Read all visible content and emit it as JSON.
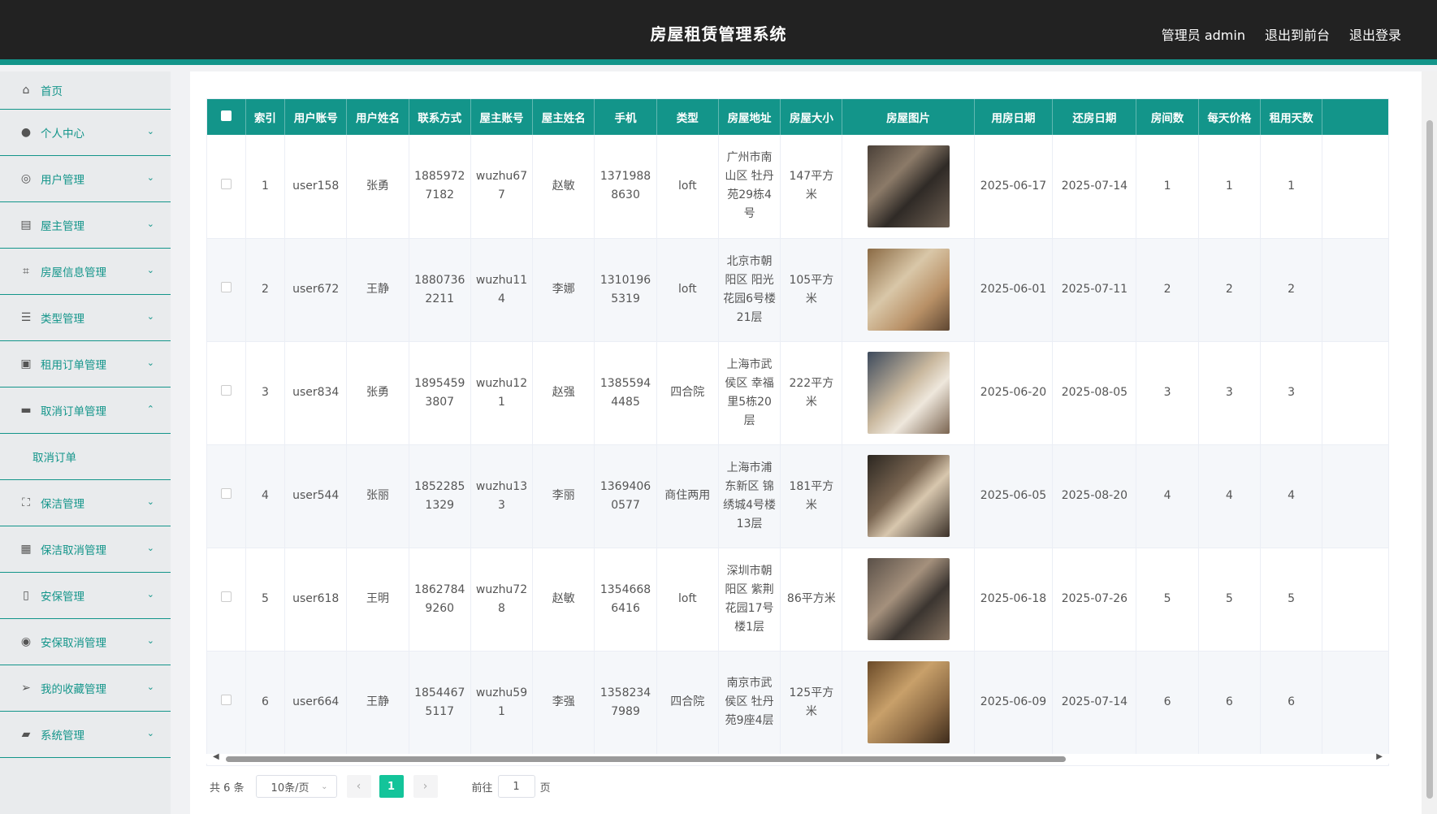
{
  "header": {
    "title": "房屋租赁管理系统",
    "admin_label": "管理员 admin",
    "exit_front": "退出到前台",
    "logout": "退出登录"
  },
  "sidebar": {
    "items": [
      {
        "label": "首页",
        "icon": "home-icon"
      },
      {
        "label": "个人中心",
        "icon": "user-icon"
      },
      {
        "label": "用户管理",
        "icon": "compass-icon"
      },
      {
        "label": "屋主管理",
        "icon": "clipboard-icon"
      },
      {
        "label": "房屋信息管理",
        "icon": "crop-icon"
      },
      {
        "label": "类型管理",
        "icon": "list-icon"
      },
      {
        "label": "租用订单管理",
        "icon": "checklist-icon"
      },
      {
        "label": "取消订单管理",
        "icon": "cancel-icon"
      },
      {
        "label": "保洁管理",
        "icon": "fullscreen-icon"
      },
      {
        "label": "保洁取消管理",
        "icon": "briefcase-icon"
      },
      {
        "label": "安保管理",
        "icon": "mobile-icon"
      },
      {
        "label": "安保取消管理",
        "icon": "target-icon"
      },
      {
        "label": "我的收藏管理",
        "icon": "send-icon"
      },
      {
        "label": "系统管理",
        "icon": "server-icon"
      }
    ],
    "submenu": "取消订单"
  },
  "table": {
    "headers": [
      "索引",
      "用户账号",
      "用户姓名",
      "联系方式",
      "屋主账号",
      "屋主姓名",
      "手机",
      "类型",
      "房屋地址",
      "房屋大小",
      "房屋图片",
      "用房日期",
      "还房日期",
      "房间数",
      "每天价格",
      "租用天数"
    ],
    "rows": [
      {
        "index": "1",
        "user_account": "user158",
        "user_name": "张勇",
        "contact": "18859727182",
        "owner_account": "wuzhu677",
        "owner_name": "赵敏",
        "phone": "13719888630",
        "type": "loft",
        "address": "广州市南山区 牡丹苑29栋4号",
        "size": "147平方米",
        "start": "2025-06-17",
        "end": "2025-07-14",
        "rooms": "1",
        "price": "1",
        "days": "1"
      },
      {
        "index": "2",
        "user_account": "user672",
        "user_name": "王静",
        "contact": "18807362211",
        "owner_account": "wuzhu114",
        "owner_name": "李娜",
        "phone": "13101965319",
        "type": "loft",
        "address": "北京市朝阳区 阳光花园6号楼21层",
        "size": "105平方米",
        "start": "2025-06-01",
        "end": "2025-07-11",
        "rooms": "2",
        "price": "2",
        "days": "2"
      },
      {
        "index": "3",
        "user_account": "user834",
        "user_name": "张勇",
        "contact": "18954593807",
        "owner_account": "wuzhu121",
        "owner_name": "赵强",
        "phone": "13855944485",
        "type": "四合院",
        "address": "上海市武侯区 幸福里5栋20层",
        "size": "222平方米",
        "start": "2025-06-20",
        "end": "2025-08-05",
        "rooms": "3",
        "price": "3",
        "days": "3"
      },
      {
        "index": "4",
        "user_account": "user544",
        "user_name": "张丽",
        "contact": "18522851329",
        "owner_account": "wuzhu133",
        "owner_name": "李丽",
        "phone": "13694060577",
        "type": "商住两用",
        "address": "上海市浦东新区 锦绣城4号楼13层",
        "size": "181平方米",
        "start": "2025-06-05",
        "end": "2025-08-20",
        "rooms": "4",
        "price": "4",
        "days": "4"
      },
      {
        "index": "5",
        "user_account": "user618",
        "user_name": "王明",
        "contact": "18627849260",
        "owner_account": "wuzhu728",
        "owner_name": "赵敏",
        "phone": "13546686416",
        "type": "loft",
        "address": "深圳市朝阳区 紫荆花园17号楼1层",
        "size": "86平方米",
        "start": "2025-06-18",
        "end": "2025-07-26",
        "rooms": "5",
        "price": "5",
        "days": "5"
      },
      {
        "index": "6",
        "user_account": "user664",
        "user_name": "王静",
        "contact": "18544675117",
        "owner_account": "wuzhu591",
        "owner_name": "李强",
        "phone": "13582347989",
        "type": "四合院",
        "address": "南京市武侯区 牡丹苑9座4层",
        "size": "125平方米",
        "start": "2025-06-09",
        "end": "2025-07-14",
        "rooms": "6",
        "price": "6",
        "days": "6"
      }
    ]
  },
  "pagination": {
    "total": "共 6 条",
    "page_size": "10条/页",
    "current_page": "1",
    "goto_label": "前往",
    "goto_value": "1",
    "page_suffix": "页"
  },
  "colors": {
    "accent": "#13958a",
    "header_bg": "#222222",
    "page_active": "#13c49a"
  }
}
